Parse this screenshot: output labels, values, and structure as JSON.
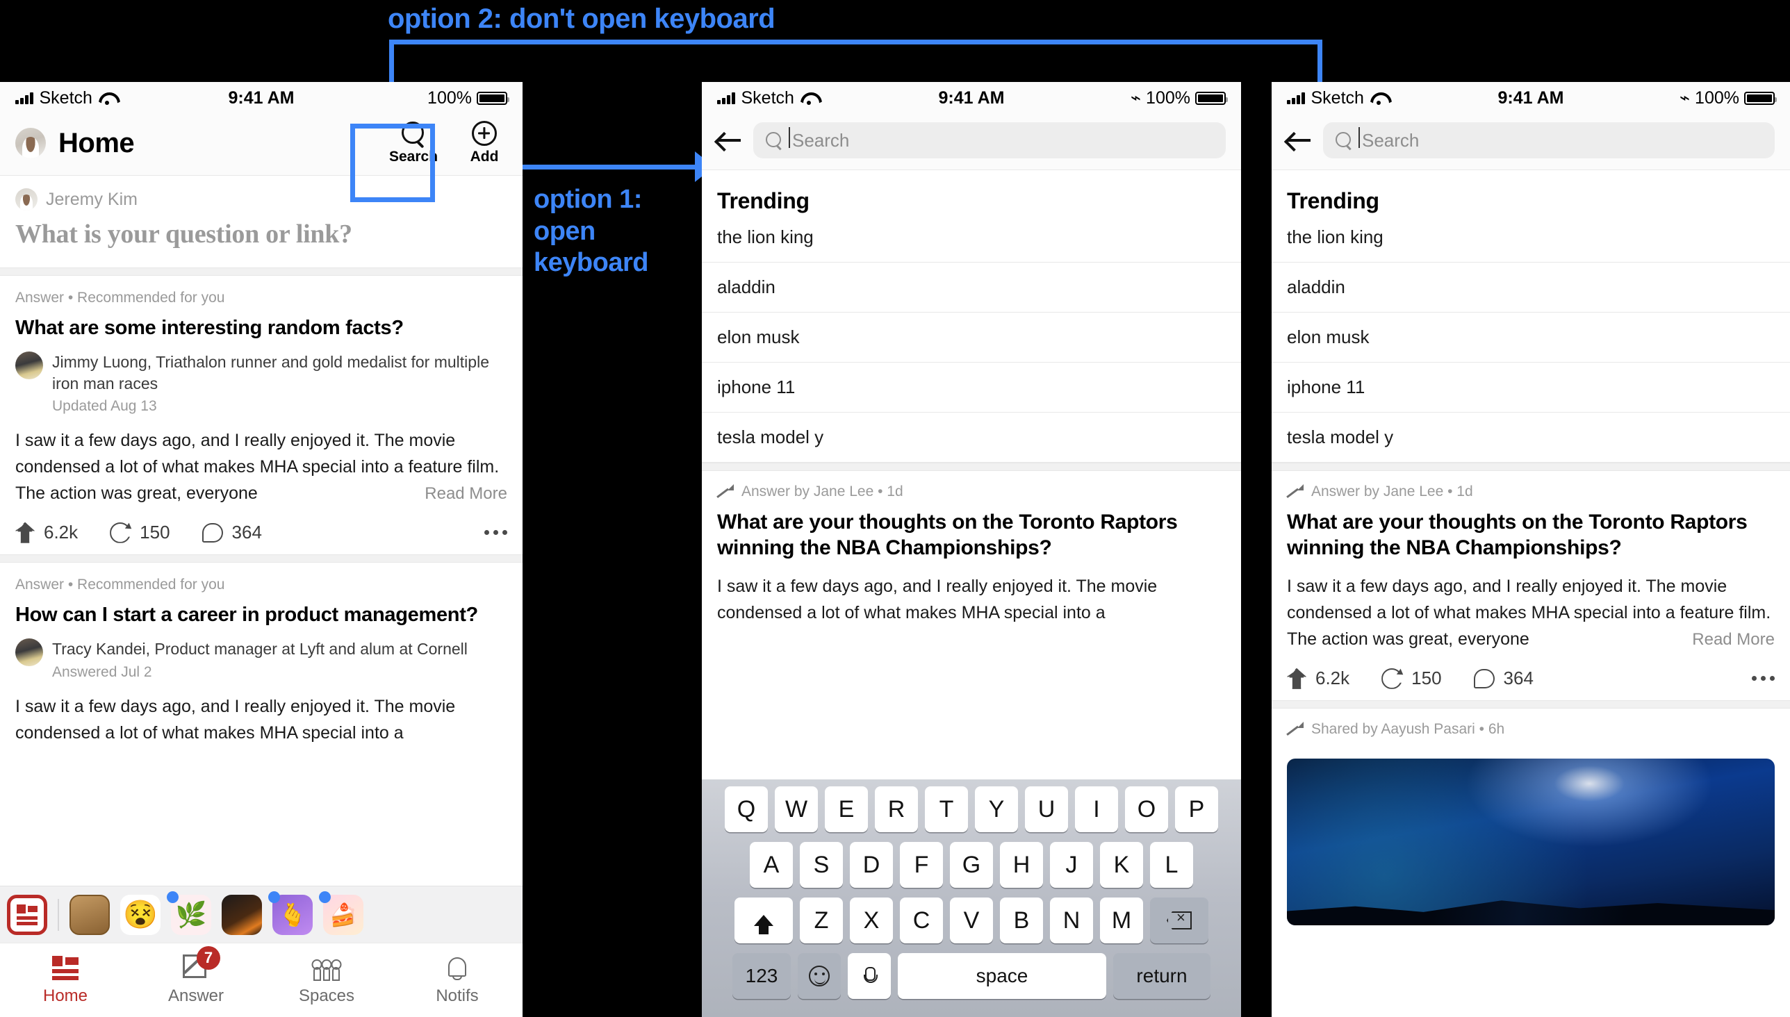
{
  "annotations": {
    "option2": "option 2: don't open keyboard",
    "option1": "option 1:\nopen\nkeyboard",
    "accent": "#3d85f7"
  },
  "phone1": {
    "status": {
      "carrier": "Sketch",
      "time": "9:41 AM",
      "battery": "100%"
    },
    "header": {
      "title": "Home",
      "search_label": "Search",
      "add_label": "Add"
    },
    "composer": {
      "user": "Jeremy Kim",
      "placeholder": "What is your question or link?"
    },
    "cards": [
      {
        "meta": "Answer • Recommended for you",
        "title": "What are some interesting random facts?",
        "author": "Jimmy  Luong, Triathalon runner and gold medalist for multiple iron man races",
        "date": "Updated Aug 13",
        "body": "I saw it a few days ago, and I really enjoyed it. The movie condensed a lot of what makes MHA special into a feature film. The action was great, everyone",
        "read_more": "Read More",
        "upvotes": "6.2k",
        "reshares": "150",
        "comments": "364"
      },
      {
        "meta": "Answer • Recommended for you",
        "title": "How can I start a career in product management?",
        "author": "Tracy  Kandei, Product manager at Lyft and alum at Cornell",
        "date": "Answered Jul 2",
        "body": "I saw it a few days ago, and I really enjoyed it. The movie condensed a lot of what makes MHA special into a"
      }
    ],
    "tabs": [
      {
        "label": "Home",
        "badge": ""
      },
      {
        "label": "Answer",
        "badge": "7"
      },
      {
        "label": "Spaces",
        "badge": ""
      },
      {
        "label": "Notifs",
        "badge": ""
      }
    ]
  },
  "phone2": {
    "status": {
      "carrier": "Sketch",
      "time": "9:41 AM",
      "battery": "100%"
    },
    "search": {
      "placeholder": "Search"
    },
    "trending_title": "Trending",
    "trending": [
      "the lion king",
      "aladdin",
      "elon musk",
      "iphone 11",
      "tesla model y"
    ],
    "post": {
      "meta": "Answer by Jane Lee • 1d",
      "title": "What are your thoughts on the Toronto Raptors winning the NBA Championships?",
      "body": "I saw it a few days ago, and I really enjoyed it. The movie condensed a lot of what makes MHA special into a"
    },
    "keyboard": {
      "row1": [
        "Q",
        "W",
        "E",
        "R",
        "T",
        "Y",
        "U",
        "I",
        "O",
        "P"
      ],
      "row2": [
        "A",
        "S",
        "D",
        "F",
        "G",
        "H",
        "J",
        "K",
        "L"
      ],
      "row3": [
        "Z",
        "X",
        "C",
        "V",
        "B",
        "N",
        "M"
      ],
      "numbers": "123",
      "space": "space",
      "return": "return"
    }
  },
  "phone3": {
    "status": {
      "carrier": "Sketch",
      "time": "9:41 AM",
      "battery": "100%"
    },
    "search": {
      "placeholder": "Search"
    },
    "trending_title": "Trending",
    "trending": [
      "the lion king",
      "aladdin",
      "elon musk",
      "iphone 11",
      "tesla model y"
    ],
    "post": {
      "meta": "Answer by Jane Lee • 1d",
      "title": "What are your thoughts on the Toronto Raptors winning the NBA Championships?",
      "body": "I saw it a few days ago, and I really enjoyed it. The movie condensed a lot of what makes MHA special into a feature film. The action was great, everyone",
      "read_more": "Read More",
      "upvotes": "6.2k",
      "reshares": "150",
      "comments": "364"
    },
    "post2": {
      "meta": "Shared by Aayush Pasari • 6h"
    }
  }
}
